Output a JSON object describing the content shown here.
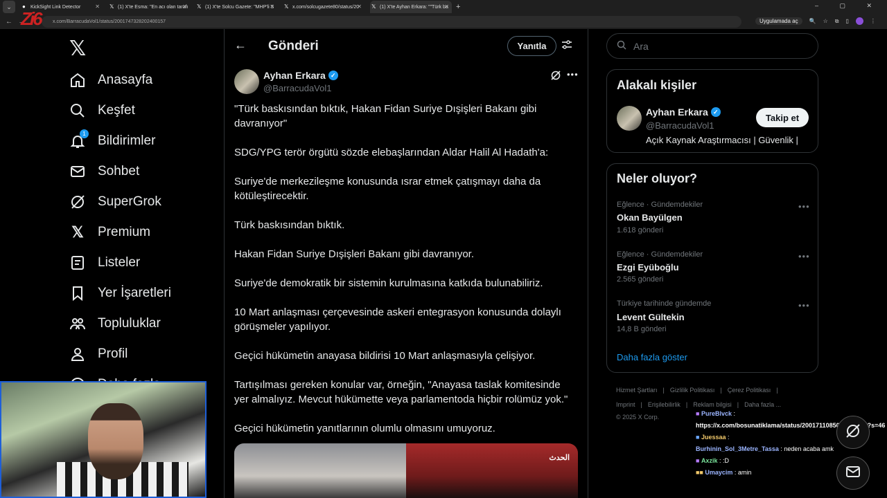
{
  "browser": {
    "tabs": [
      {
        "label": "KickSight Link Detector",
        "active": false
      },
      {
        "label": "(1) X'te Esma: \"En acı olan tarafı",
        "active": false
      },
      {
        "label": "(1) X'te Solcu Gazete: \"MHP'li S",
        "active": false
      },
      {
        "label": "x.com/solcugazete80/status/20",
        "active": false
      },
      {
        "label": "(1) X'te Ayhan Erkara: \"\"Türk ba",
        "active": true
      }
    ],
    "url": "x.com/BarracudaVol1/status/2001747328202400157",
    "open_in_app": "Uygulamada aç",
    "logo_text": "Zi6"
  },
  "nav": {
    "items": [
      {
        "label": "Anasayfa",
        "icon": "home-icon"
      },
      {
        "label": "Keşfet",
        "icon": "search-icon"
      },
      {
        "label": "Bildirimler",
        "icon": "bell-icon",
        "badge": "1"
      },
      {
        "label": "Sohbet",
        "icon": "mail-icon"
      },
      {
        "label": "SuperGrok",
        "icon": "grok-icon"
      },
      {
        "label": "Premium",
        "icon": "x-icon"
      },
      {
        "label": "Listeler",
        "icon": "list-icon"
      },
      {
        "label": "Yer İşaretleri",
        "icon": "bookmark-icon"
      },
      {
        "label": "Topluluklar",
        "icon": "people-icon"
      },
      {
        "label": "Profil",
        "icon": "user-icon"
      },
      {
        "label": "Daha fazla",
        "icon": "more-circle-icon"
      }
    ]
  },
  "header": {
    "title": "Gönderi",
    "reply_label": "Yanıtla"
  },
  "post": {
    "author_name": "Ayhan Erkara",
    "author_handle": "@BarracudaVol1",
    "paragraphs": [
      "\"Türk baskısından bıktık, Hakan Fidan Suriye Dışişleri Bakanı gibi davranıyor\"",
      "SDG/YPG terör örgütü sözde elebaşlarından Aldar Halil Al Hadath'a:",
      "Suriye'de merkezileşme konusunda ısrar etmek çatışmayı daha da kötüleştirecektir.",
      "Türk baskısından bıktık.",
      "Hakan Fidan Suriye Dışişleri Bakanı gibi davranıyor.",
      "Suriye'de demokratik bir sistemin kurulmasına katkıda bulunabiliriz.",
      "10 Mart anlaşması çerçevesinde askeri entegrasyon konusunda dolaylı görüşmeler yapılıyor.",
      "Geçici hükümetin anayasa bildirisi 10 Mart anlaşmasıyla çelişiyor.",
      "Tartışılması gereken konular var, örneğin, \"Anayasa taslak komitesinde yer almalıyız. Mevcut hükümette veya parlamentoda hiçbir rolümüz yok.\"",
      "Geçici hükümetin yanıtlarının olumlu olmasını umuyoruz."
    ],
    "media_caption": "الحدث"
  },
  "search": {
    "placeholder": "Ara"
  },
  "related": {
    "title": "Alakalı kişiler",
    "name": "Ayhan Erkara",
    "handle": "@BarracudaVol1",
    "bio": "Açık Kaynak Araştırmacısı | Güvenlik |",
    "follow_label": "Takip et"
  },
  "trends": {
    "title": "Neler oluyor?",
    "items": [
      {
        "context": "Eğlence · Gündemdekiler",
        "name": "Okan Bayülgen",
        "count": "1.618 gönderi"
      },
      {
        "context": "Eğlence · Gündemdekiler",
        "name": "Ezgi Eyüboğlu",
        "count": "2.565 gönderi"
      },
      {
        "context": "Türkiye tarihinde gündemde",
        "name": "Levent Gültekin",
        "count": "14,8 B gönderi"
      }
    ],
    "show_more": "Daha fazla göster"
  },
  "footer": {
    "row1": [
      "Hizmet Şartları",
      "|",
      "Gizlilik Politikası",
      "|",
      "Çerez Politikası",
      "|"
    ],
    "row2": [
      "Imprint",
      "|",
      "Erişilebilirlik",
      "|",
      "Reklam bilgisi",
      "|",
      "Daha fazla ..."
    ],
    "copyright": "© 2025 X Corp."
  },
  "chat": {
    "messages": [
      {
        "user": "PureBlvck",
        "text": ":"
      },
      {
        "user": "",
        "text": "https://x.com/bosunatiklama/status/2001711085083410753?s=46"
      },
      {
        "user": "Juessaa",
        "text": ":"
      },
      {
        "user": "Burhinin_Sol_3Metre_Tassa",
        "text": ": neden acaba amk"
      },
      {
        "user": "Axzik",
        "text": ": :D"
      },
      {
        "user": "Umaycim",
        "text": ": amin"
      }
    ]
  }
}
